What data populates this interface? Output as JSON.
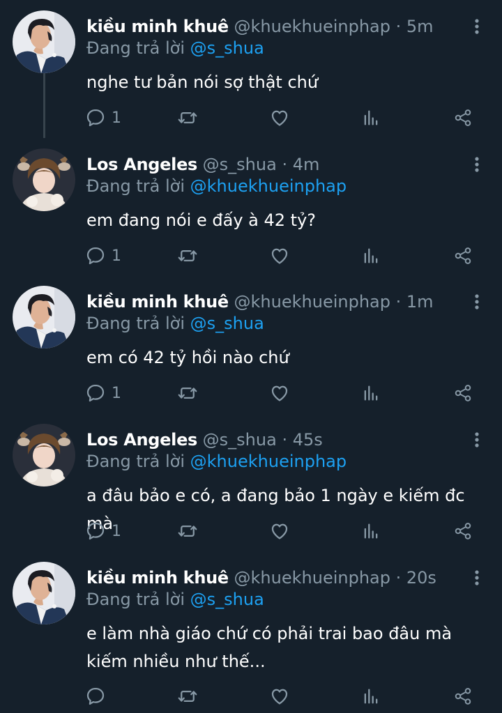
{
  "colors": {
    "background": "#15202b",
    "text": "#ffffff",
    "muted": "#8899a6",
    "link": "#1da1f2",
    "thread_line": "#38444d"
  },
  "icons": {
    "reply": "reply-icon",
    "retweet": "retweet-icon",
    "like": "heart-icon",
    "stats": "analytics-icon",
    "share": "share-icon",
    "more": "more-vertical-icon"
  },
  "tweets": [
    {
      "display_name": "kiều minh khuê",
      "handle": "@khuekhueinphap",
      "separator": "·",
      "time": "5m",
      "reply_prefix": "Đang trả lời",
      "reply_mention": "@s_shua",
      "lines": [
        "nghe tư bản nói sợ thật chứ"
      ],
      "reply_count": "1"
    },
    {
      "display_name": "Los Angeles",
      "handle": "@s_shua",
      "separator": "·",
      "time": "4m",
      "reply_prefix": "Đang trả lời",
      "reply_mention": "@khuekhueinphap",
      "lines": [
        "em đang nói e đấy à 42 tỷ?"
      ],
      "reply_count": "1"
    },
    {
      "display_name": "kiều minh khuê",
      "handle": "@khuekhueinphap",
      "separator": "·",
      "time": "1m",
      "reply_prefix": "Đang trả lời",
      "reply_mention": "@s_shua",
      "lines": [
        "em có 42 tỷ hồi nào chứ"
      ],
      "reply_count": "1"
    },
    {
      "display_name": "Los Angeles",
      "handle": "@s_shua",
      "separator": "·",
      "time": "45s",
      "reply_prefix": "Đang trả lời",
      "reply_mention": "@khuekhueinphap",
      "lines": [
        "a đâu bảo e có, a đang bảo 1 ngày e kiếm đc mà"
      ],
      "reply_count": "1"
    },
    {
      "display_name": "kiều minh khuê",
      "handle": "@khuekhueinphap",
      "separator": "·",
      "time": "20s",
      "reply_prefix": "Đang trả lời",
      "reply_mention": "@s_shua",
      "lines": [
        "e làm nhà giáo chứ có phải trai bao đâu mà",
        "kiếm nhiều như thế..."
      ],
      "reply_count": ""
    }
  ]
}
